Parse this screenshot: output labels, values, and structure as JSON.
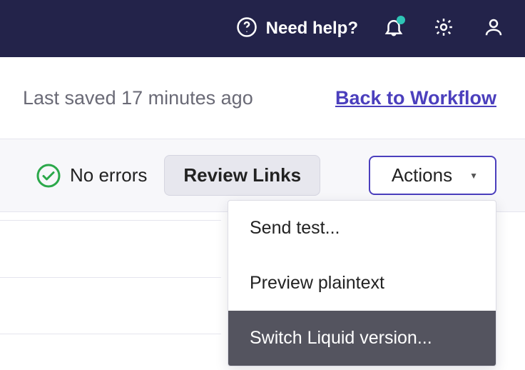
{
  "topbar": {
    "help_label": "Need help?"
  },
  "subheader": {
    "saved_text": "Last saved 17 minutes ago",
    "back_link": "Back to Workflow"
  },
  "toolbar": {
    "status_text": "No errors",
    "review_links_label": "Review Links",
    "actions_label": "Actions"
  },
  "actions_menu": {
    "items": [
      {
        "label": "Send test..."
      },
      {
        "label": "Preview plaintext"
      },
      {
        "label": "Switch Liquid version..."
      }
    ]
  }
}
